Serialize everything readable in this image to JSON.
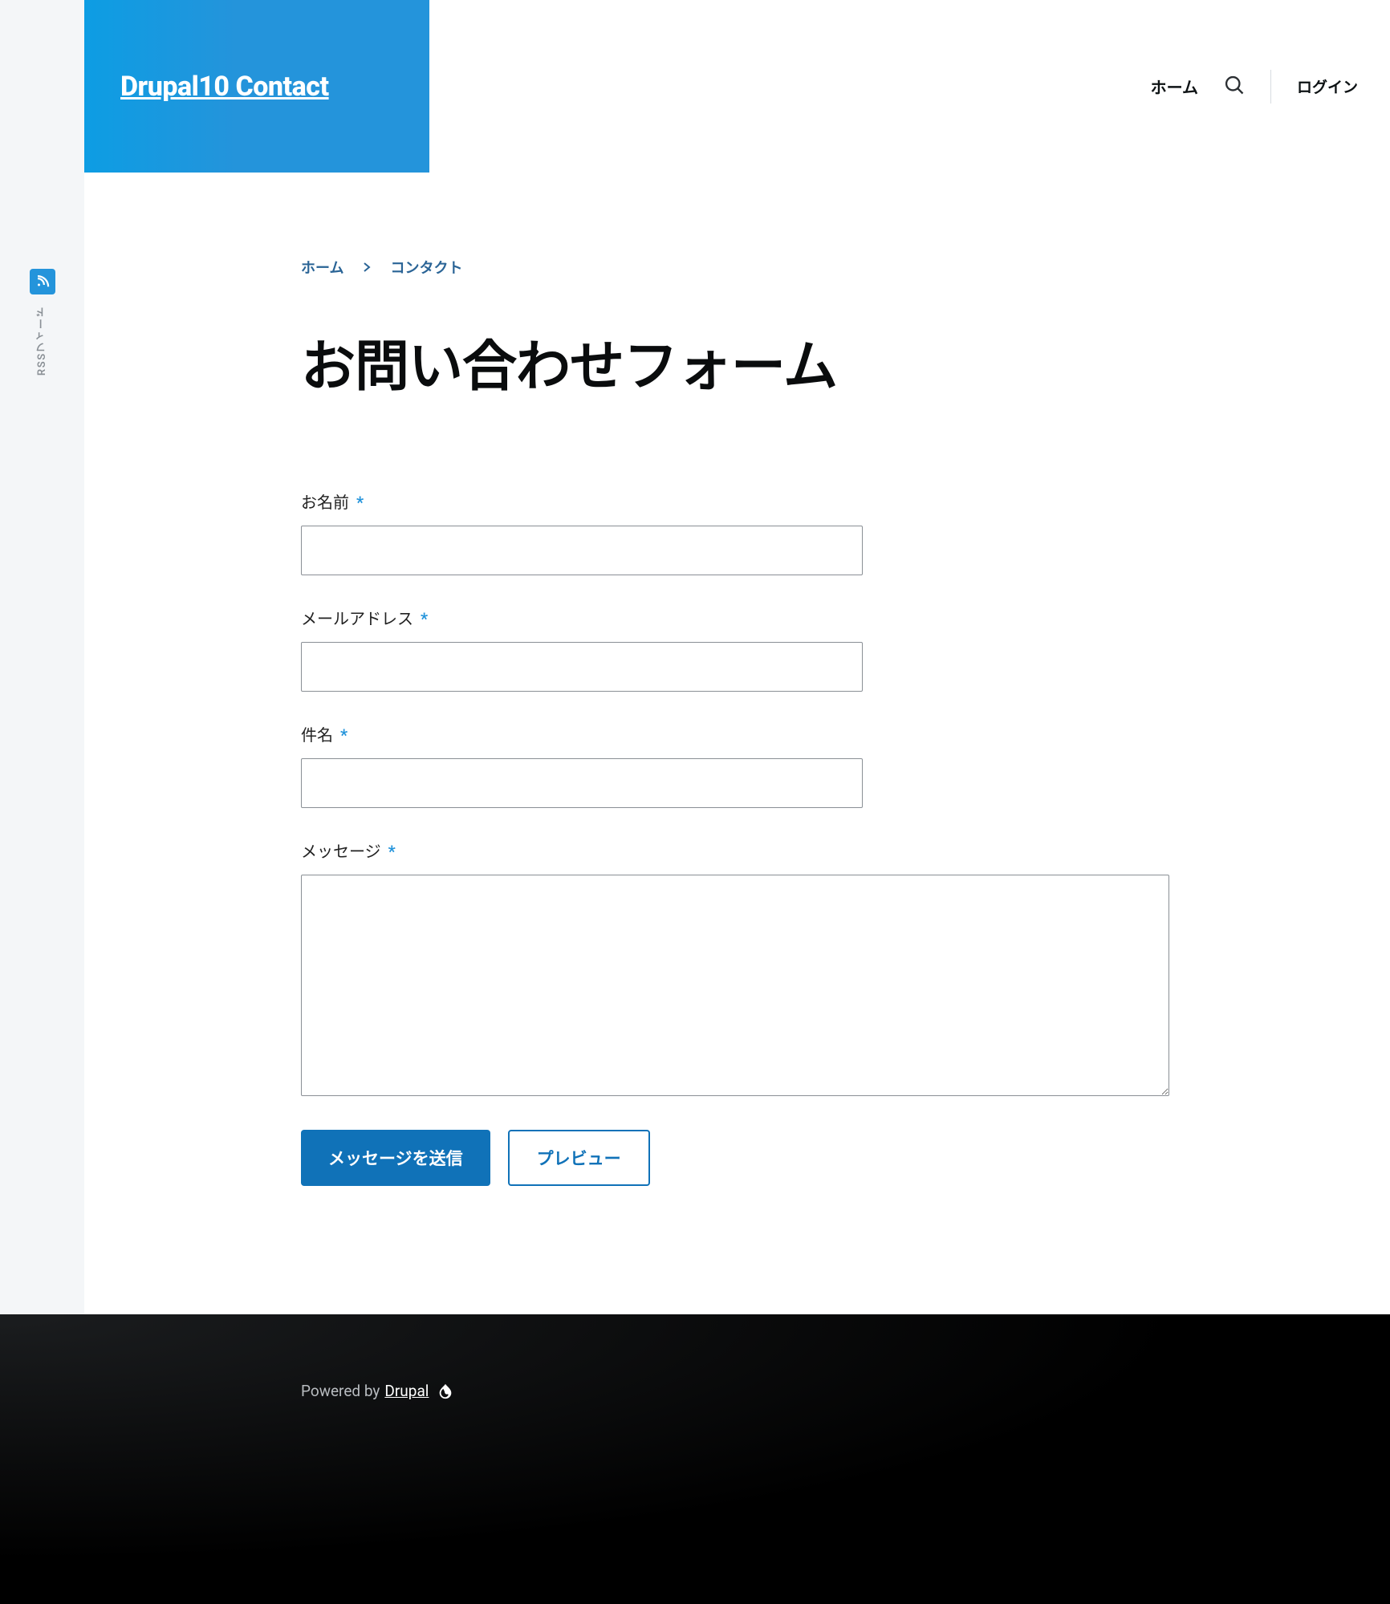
{
  "brand": {
    "title": "Drupal10 Contact"
  },
  "nav": {
    "home": "ホーム",
    "login": "ログイン",
    "search_icon": "search-icon"
  },
  "social": {
    "rss_label": "RSSフィード",
    "rss_icon": "rss-icon"
  },
  "breadcrumb": {
    "home": "ホーム",
    "current": "コンタクト"
  },
  "page": {
    "title": "お問い合わせフォーム"
  },
  "form": {
    "name_label": "お名前",
    "email_label": "メールアドレス",
    "subject_label": "件名",
    "message_label": "メッセージ",
    "required_mark": "*",
    "name_value": "",
    "email_value": "",
    "subject_value": "",
    "message_value": "",
    "submit_label": "メッセージを送信",
    "preview_label": "プレビュー"
  },
  "footer": {
    "powered_prefix": "Powered by",
    "powered_link": "Drupal",
    "drupal_icon": "drupal-drop-icon"
  },
  "colors": {
    "accent": "#2494db",
    "primary_button": "#1072b8"
  }
}
